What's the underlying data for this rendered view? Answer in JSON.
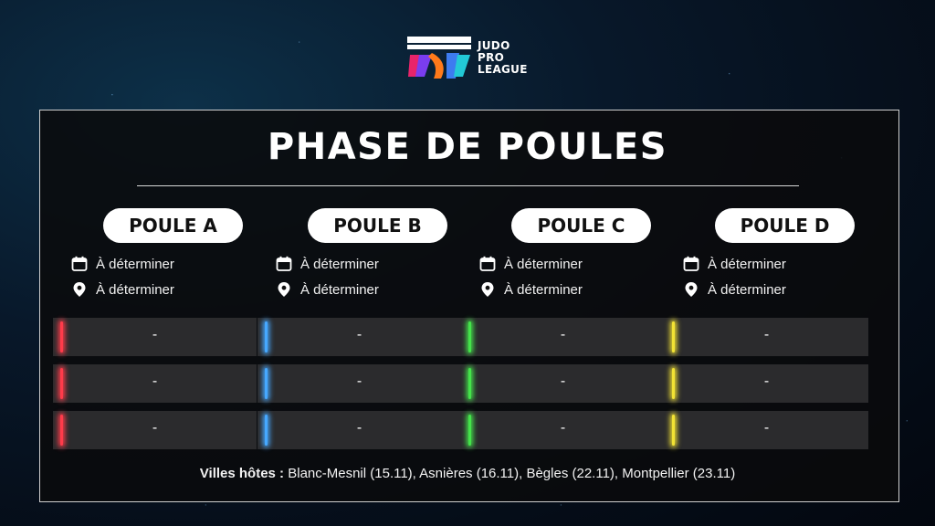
{
  "logo": {
    "line1": "JUDO",
    "line2": "PRO",
    "line3": "LEAGUE",
    "name": "judo-pro-league-logo"
  },
  "title": "PHASE DE POULES",
  "pools": [
    {
      "name": "POULE A",
      "date": "À déterminer",
      "location": "À déterminer",
      "color": "#ff3b4a",
      "slots": [
        "-",
        "-",
        "-"
      ]
    },
    {
      "name": "POULE B",
      "date": "À déterminer",
      "location": "À déterminer",
      "color": "#46a8ff",
      "slots": [
        "-",
        "-",
        "-"
      ]
    },
    {
      "name": "POULE C",
      "date": "À déterminer",
      "location": "À déterminer",
      "color": "#44e34a",
      "slots": [
        "-",
        "-",
        "-"
      ]
    },
    {
      "name": "POULE D",
      "date": "À déterminer",
      "location": "À déterminer",
      "color": "#f2e234",
      "slots": [
        "-",
        "-",
        "-"
      ]
    }
  ],
  "footer": {
    "label": "Villes hôtes :",
    "cities": " Blanc-Mesnil (15.11), Asnières (16.11), Bègles (22.11), Montpellier (23.11)"
  },
  "icons": {
    "date": "calendar-icon",
    "location": "map-pin-icon"
  }
}
